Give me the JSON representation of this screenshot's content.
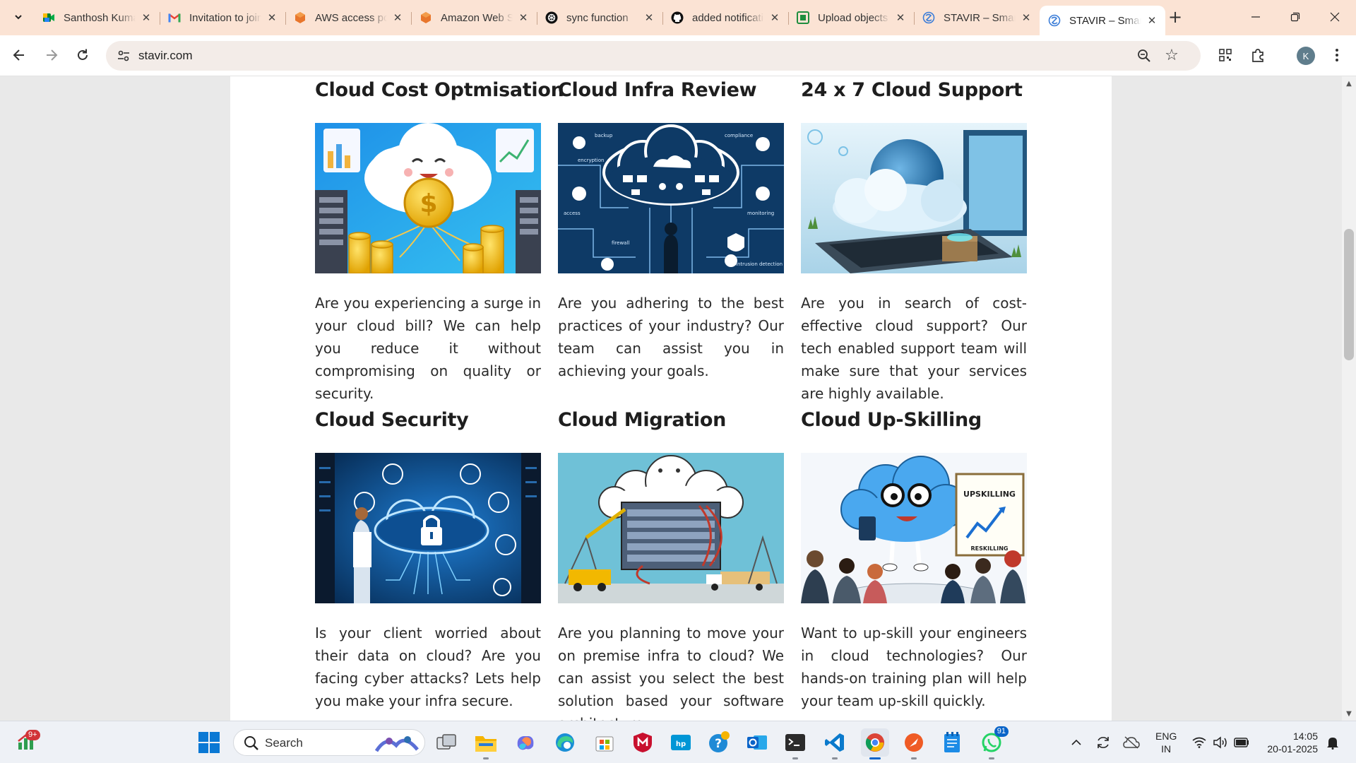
{
  "tabs": [
    {
      "title": "Santhosh Kumar",
      "favicon": "google-meet-icon"
    },
    {
      "title": "Invitation to join",
      "favicon": "gmail-icon"
    },
    {
      "title": "AWS access portal",
      "favicon": "aws-icon"
    },
    {
      "title": "Amazon Web Services",
      "favicon": "aws-icon"
    },
    {
      "title": "sync function",
      "favicon": "openai-icon"
    },
    {
      "title": "added notifications",
      "favicon": "github-icon"
    },
    {
      "title": "Upload objects",
      "favicon": "upload-icon"
    },
    {
      "title": "STAVIR – Smart",
      "favicon": "stavir-icon"
    },
    {
      "title": "STAVIR – Smart",
      "favicon": "stavir-icon"
    }
  ],
  "toolbar": {
    "url": "stavir.com",
    "avatar_letter": "K"
  },
  "services": [
    {
      "title": "Cloud Cost Optmisation",
      "description": "Are you experiencing a surge in your cloud bill? We can help you reduce it without compromising on quality or security."
    },
    {
      "title": "Cloud Infra Review",
      "description": "Are you adhering to the best practices of your industry? Our team can assist you in achieving your goals."
    },
    {
      "title": "24 x 7 Cloud Support",
      "description": "Are you in search of cost-effective cloud support? Our tech enabled support team will make sure that your services are highly available."
    },
    {
      "title": "Cloud Security",
      "description": "Is your client worried about their data on cloud? Are you facing cyber attacks? Lets help you make your infra secure."
    },
    {
      "title": "Cloud Migration",
      "description": "Are you planning to move your on premise infra to cloud? We can assist you select the best solution based your software architecture."
    },
    {
      "title": "Cloud Up-Skilling",
      "description": "Want to up-skill your engineers in cloud technologies? Our hands-on training plan will help your team up-skill quickly."
    }
  ],
  "image_text": {
    "upskilling": "UPSKILLING",
    "reskilling": "RESKILLING",
    "infra_labels": [
      "backup",
      "encryption",
      "firewall",
      "compliance",
      "intrusion detection",
      "access",
      "monitoring"
    ]
  },
  "taskbar": {
    "widgets_badge": "9+",
    "search_placeholder": "Search",
    "whatsapp_badge": "91",
    "lang_line1": "ENG",
    "lang_line2": "IN",
    "time": "14:05",
    "date": "20-01-2025"
  },
  "colors": {
    "tabstrip_bg": "#fbe3d4",
    "accent": "#0a64c8",
    "heading": "#1e1e1e",
    "body_text": "#2b2b2b"
  }
}
